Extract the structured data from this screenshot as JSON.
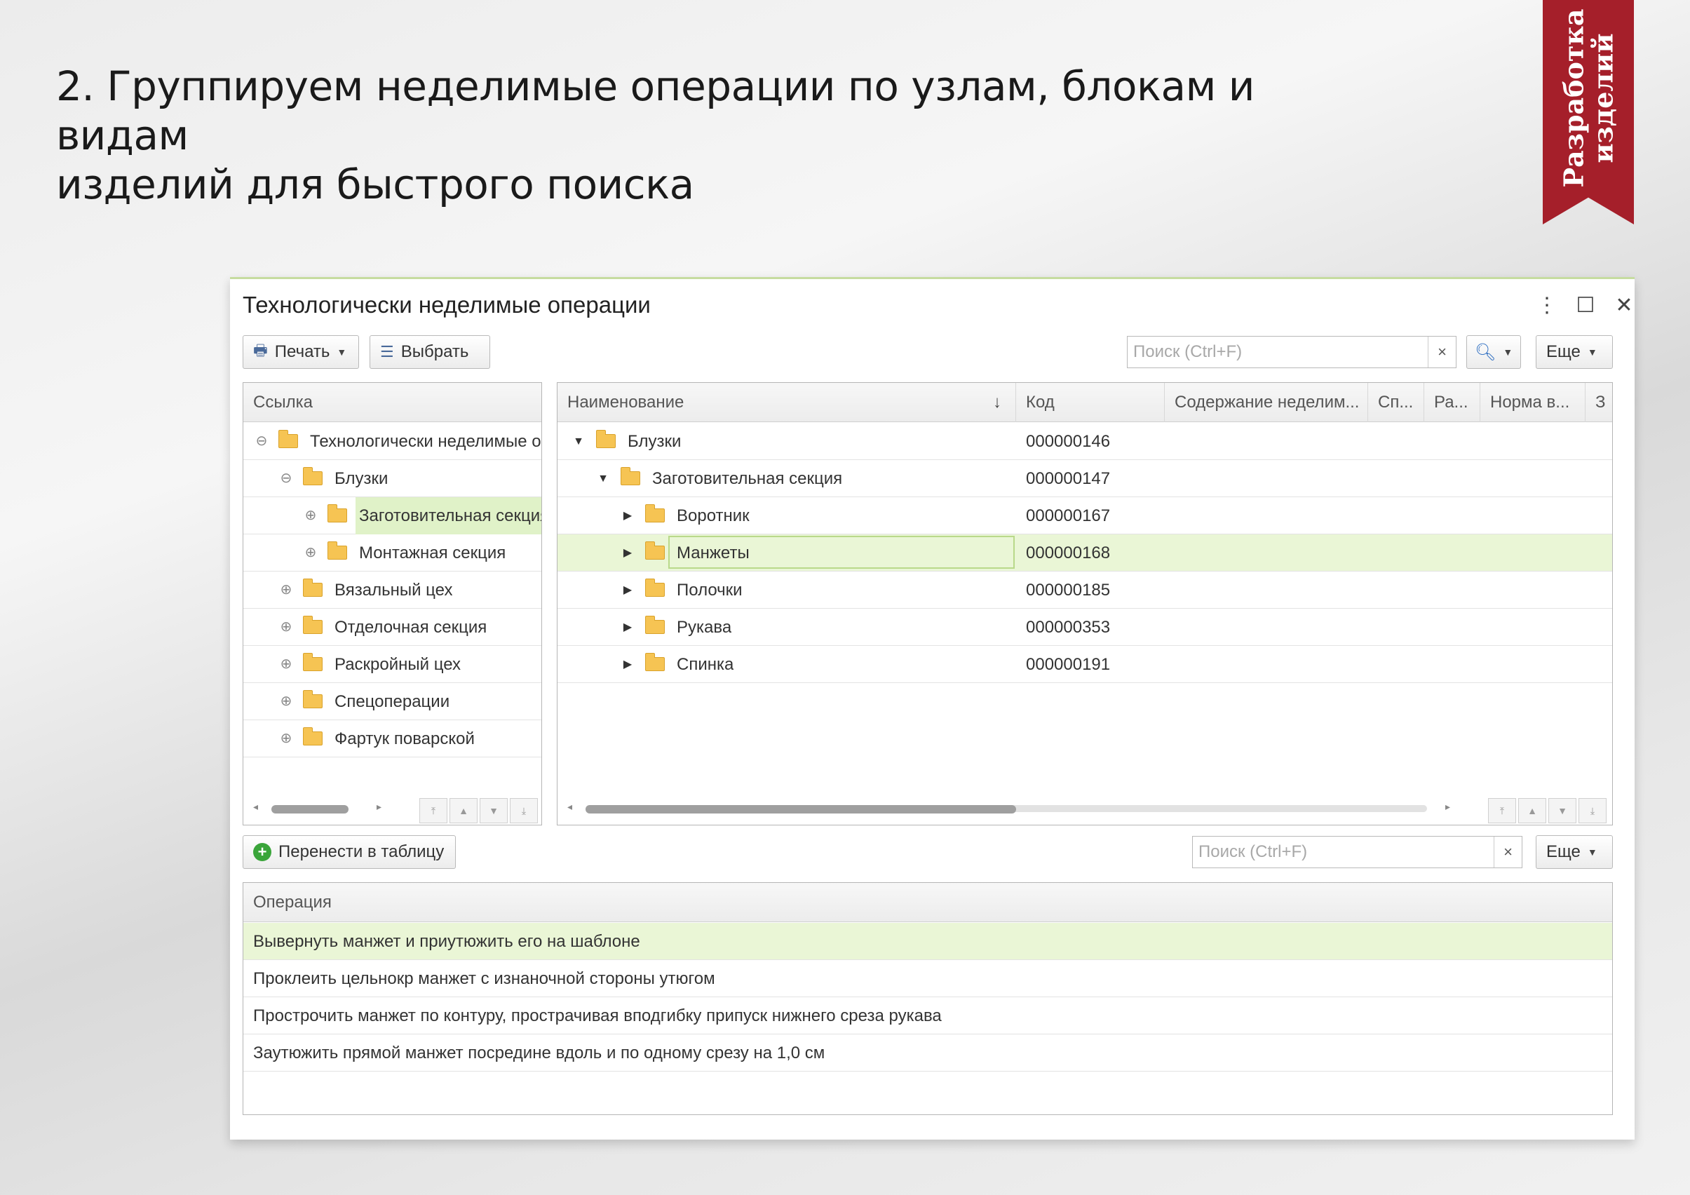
{
  "slide": {
    "title_line1": "2. Группируем неделимые операции по узлам, блокам и видам",
    "title_line2": "изделий для быстрого поиска",
    "ribbon_line1": "Разработка",
    "ribbon_line2": "изделий",
    "ribbon_color": "#a51f2a"
  },
  "window": {
    "title": "Технологически неделимые операции",
    "controls": {
      "more": "⋮",
      "maximize": "☐",
      "close": "✕"
    }
  },
  "toolbar": {
    "print_label": "Печать",
    "select_label": "Выбрать",
    "search_placeholder": "Поиск (Ctrl+F)",
    "search_clear": "×",
    "search_icon": "search-icon",
    "more_label": "Еще"
  },
  "tree": {
    "header": "Ссылка",
    "items": [
      {
        "label": "Технологически неделимые операции",
        "expander": "⊖"
      },
      {
        "label": "Блузки",
        "expander": "⊖"
      },
      {
        "label": "Заготовительная секция",
        "expander": "⊕"
      },
      {
        "label": "Монтажная секция",
        "expander": "⊕"
      },
      {
        "label": "Вязальный цех",
        "expander": "⊕"
      },
      {
        "label": "Отделочная секция",
        "expander": "⊕"
      },
      {
        "label": "Раскройный цех",
        "expander": "⊕"
      },
      {
        "label": "Спецоперации",
        "expander": "⊕"
      },
      {
        "label": "Фартук поварской",
        "expander": "⊕"
      }
    ]
  },
  "grid": {
    "columns": {
      "name": "Наименование",
      "sort_icon": "↓",
      "code": "Код",
      "content": "Содержание неделим...",
      "c4": "Сп...",
      "c5": "Ра...",
      "norm": "Норма в...",
      "c7": "З"
    },
    "rows": [
      {
        "name": "Блузки",
        "code": "000000146",
        "toggle": "▼"
      },
      {
        "name": "Заготовительная секция",
        "code": "000000147",
        "toggle": "▼"
      },
      {
        "name": "Воротник",
        "code": "000000167",
        "toggle": "▶"
      },
      {
        "name": "Манжеты",
        "code": "000000168",
        "toggle": "▶"
      },
      {
        "name": "Полочки",
        "code": "000000185",
        "toggle": "▶"
      },
      {
        "name": "Рукава",
        "code": "000000353",
        "toggle": "▶"
      },
      {
        "name": "Спинка",
        "code": "000000191",
        "toggle": "▶"
      }
    ]
  },
  "bottom": {
    "transfer_label": "Перенести в таблицу",
    "search_placeholder": "Поиск (Ctrl+F)",
    "search_clear": "×",
    "more_label": "Еще",
    "header": "Операция",
    "rows": [
      "Вывернуть  манжет и приутюжить  его на шаблоне",
      "Проклеить цельнокр манжет с изнаночной стороны утюгом",
      "Простро­чить манжет по контуру, прострачивая  вподгибку припуск нижнего среза рукава",
      "Заутюжить прямой манжет посредине вдоль и по одному срезу на 1,0 см"
    ]
  },
  "nav": {
    "first": "⤒",
    "up": "▲",
    "down": "▼",
    "last": "⤓",
    "left": "◂",
    "right": "▸"
  }
}
